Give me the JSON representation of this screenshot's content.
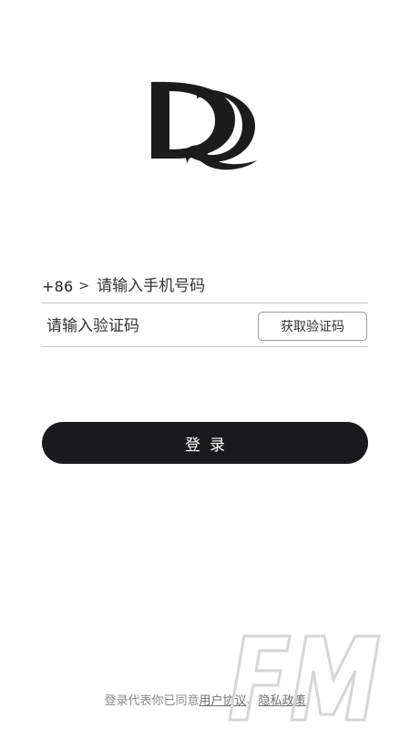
{
  "logo": {
    "letters": "DQ"
  },
  "phone": {
    "country_code": "+86",
    "chevron": ">",
    "placeholder": "请输入手机号码",
    "value": ""
  },
  "verification": {
    "placeholder": "请输入验证码",
    "value": "",
    "get_code_label": "获取验证码"
  },
  "login_button": {
    "label": "登录"
  },
  "agreement": {
    "prefix": "登录代表你已同意",
    "user_agreement": "用户协议",
    "conjunction": "、",
    "privacy_policy": "隐私政策"
  },
  "watermark": {
    "text": "FM"
  }
}
